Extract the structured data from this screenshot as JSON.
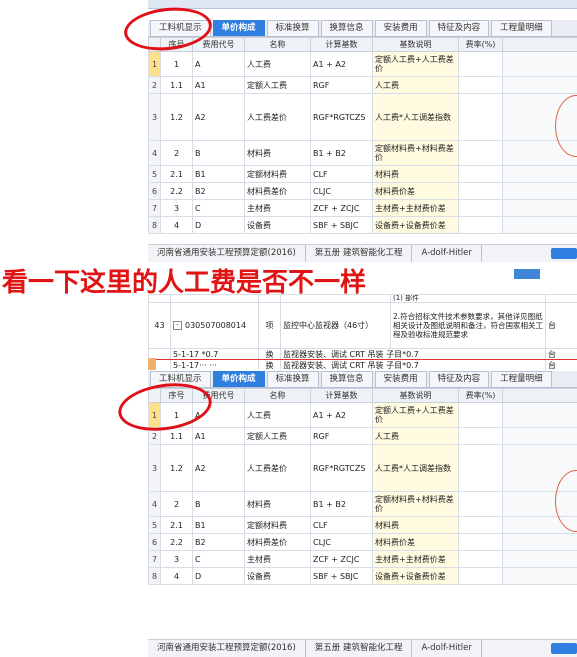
{
  "annotation": "看一下这里的人工费是否不一样",
  "tabs": [
    "工料机显示",
    "单价构成",
    "标准换算",
    "换算信息",
    "安装费用",
    "特征及内容",
    "工程量明细"
  ],
  "active_tab": "单价构成",
  "columns": [
    "序号",
    "费用代号",
    "名称",
    "计算基数",
    "基数说明",
    "费率(%)"
  ],
  "rows": [
    {
      "n": "1",
      "seq": "1",
      "code": "A",
      "name": "人工费",
      "base": "A1 + A2",
      "desc": "定额人工费+人工费差价"
    },
    {
      "n": "2",
      "seq": "1.1",
      "code": "A1",
      "name": "定额人工费",
      "base": "RGF",
      "desc": "人工费"
    },
    {
      "n": "3",
      "seq": "1.2",
      "code": "A2",
      "name": "人工费差价",
      "base": "RGF*RGTCZS",
      "desc": "人工费*人工调差指数"
    },
    {
      "n": "4",
      "seq": "2",
      "code": "B",
      "name": "材料费",
      "base": "B1 + B2",
      "desc": "定额材料费+材料费差价"
    },
    {
      "n": "5",
      "seq": "2.1",
      "code": "B1",
      "name": "定额材料费",
      "base": "CLF",
      "desc": "材料费"
    },
    {
      "n": "6",
      "seq": "2.2",
      "code": "B2",
      "name": "材料费差价",
      "base": "CLJC",
      "desc": "材料费价差"
    },
    {
      "n": "7",
      "seq": "3",
      "code": "C",
      "name": "主材费",
      "base": "ZCF + ZCJC",
      "desc": "主材费+主材费价差"
    },
    {
      "n": "8",
      "seq": "4",
      "code": "D",
      "name": "设备费",
      "base": "SBF + SBJC",
      "desc": "设备费+设备费价差"
    }
  ],
  "statusbar": [
    "河南省通用安装工程预算定额(2016)",
    "第五册 建筑智能化工程",
    "A-dolf-Hitler"
  ],
  "middle": {
    "desc_top": "(1) 部件",
    "item_row": {
      "n": "43",
      "expander": "-",
      "code": "030507008014",
      "type": "项",
      "name": "监控中心监视器（46寸）",
      "desc": "2.符合招标文件技术参数要求，其他详见图纸相关设计及图纸说明和备注，符合国家相关工程及验收标准规范要求",
      "unit": "台"
    },
    "sub_rows": [
      {
        "code": "5-1-17 *0.7",
        "type": "换",
        "name": "监视器安装、调试 CRT 吊装  子目*0.7",
        "unit": "台"
      },
      {
        "code": "5-1-17··· ···",
        "type": "换",
        "name": "监视器安装、调试 CRT 吊装  子目*0.7",
        "unit": "台"
      }
    ]
  },
  "colors": {
    "accent": "#2f7fe0",
    "annotation": "#e01414",
    "circle": "#e0101a",
    "desc_bg": "#fffbe0"
  }
}
